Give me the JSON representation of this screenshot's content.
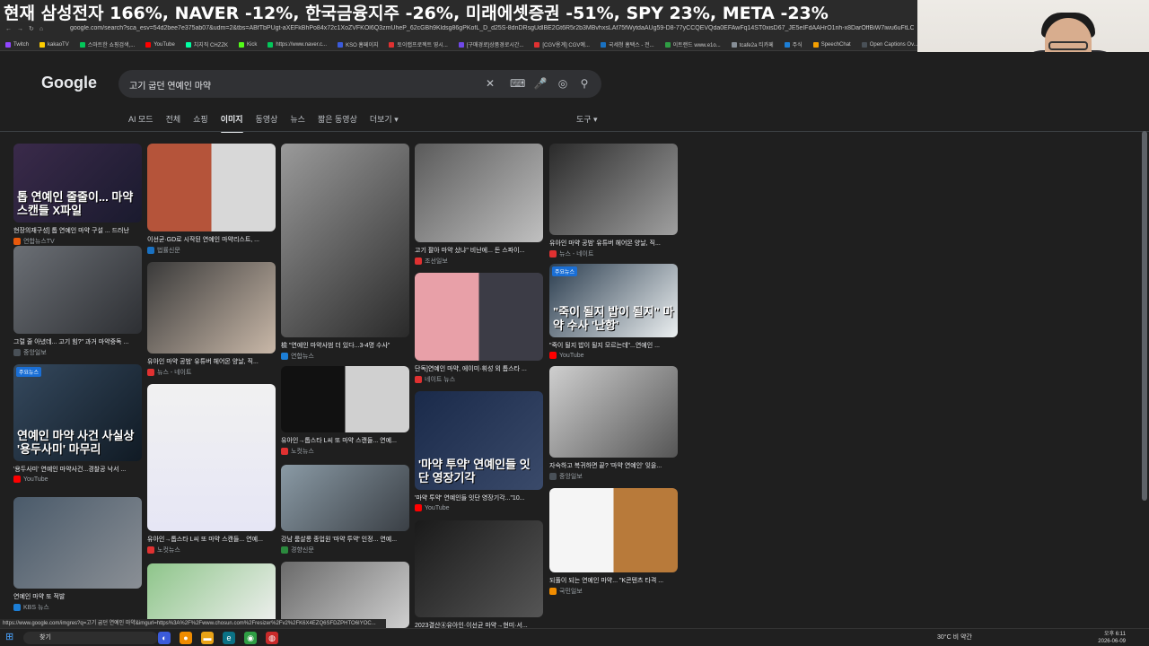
{
  "ticker": {
    "text": "현재 삼성전자 166%, NAVER -12%, 한국금융지주 -26%, 미래에셋증권 -51%, SPY 23%, META -23%"
  },
  "browser": {
    "url": "google.com/search?sca_esv=54d2bee7e375ab07&udm=2&tbs=ABfTbPUgt-aXEFkBhPo84x72c1XoZVFKOl6Q3zmUheP_62cGBh9Kldsg86gPKofL_D_d25S-8dnDRsgUdlBE2Gt6R5r2b3MBvhxsLAf75fWytdaAUg59-D8-77yCCQEVQda0EFAwFq14ST0xisD67_JE5eIFdAAHrO1nh-x8DarOffBiW7iwu6uFtLCYezyV8",
    "bookmarks": [
      {
        "label": "Twitch",
        "color": "#9146ff"
      },
      {
        "label": "kakaoTV",
        "color": "#ffcd00"
      },
      {
        "label": "스마트한 쇼핑검색,...",
        "color": "#03c75a"
      },
      {
        "label": "YouTube",
        "color": "#ff0000"
      },
      {
        "label": "치지직 CHZZK",
        "color": "#00ffa3"
      },
      {
        "label": "Kick",
        "color": "#53fc18"
      },
      {
        "label": "https://www.naver.c...",
        "color": "#03c75a"
      },
      {
        "label": "KSO 홈페이지",
        "color": "#3b5bdb"
      },
      {
        "label": "토이랩프로젝트 영시...",
        "color": "#e03131"
      },
      {
        "label": "[구매경로]상품경로시간...",
        "color": "#7048e8"
      },
      {
        "label": "[CGV용계] CGV예...",
        "color": "#e03131"
      },
      {
        "label": "국세청 홈택스 - 전...",
        "color": "#1971c2"
      },
      {
        "label": "이트랜드 www.e1o...",
        "color": "#2f9e44"
      },
      {
        "label": "tcafe2a 티카페",
        "color": "#868e96"
      },
      {
        "label": "주식",
        "color": "#1c7ed6"
      },
      {
        "label": "SpeechChat",
        "color": "#f59f00"
      },
      {
        "label": "Open Captions Ov...",
        "color": "#495057"
      }
    ]
  },
  "google": {
    "logo": "Google",
    "query": "고기 굽던 연예인 마약",
    "tabs": [
      {
        "label": "AI 모드",
        "active": false
      },
      {
        "label": "전체",
        "active": false
      },
      {
        "label": "쇼핑",
        "active": false
      },
      {
        "label": "이미지",
        "active": true
      },
      {
        "label": "동영상",
        "active": false
      },
      {
        "label": "뉴스",
        "active": false
      },
      {
        "label": "짧은 동영상",
        "active": false
      },
      {
        "label": "더보기 ▾",
        "active": false
      }
    ],
    "tools": "도구 ▾"
  },
  "results": [
    {
      "caption": "현장의재구성] 톱 연예인 마약 구설 ... 드러난",
      "source": "연합뉴스TV",
      "overlay": "톱 연예인 줄줄이... 마약 스캔들 X파일",
      "fav": "#e8590c"
    },
    {
      "caption": "그럴 줄 아녔데... 고기 힘?\" 과거 마약중독 ...",
      "source": "중앙일보",
      "overlay": "",
      "fav": "#495057"
    },
    {
      "caption": "'용두사미' 연예인 마약사건...경찰공 낙서 ...",
      "source": "YouTube",
      "overlay": "연예인 마약 사건 사실상 '용두사미' 마무리",
      "badge": "주요뉴스",
      "fav": "#ff0000"
    },
    {
      "caption": "연예인 마약 또 적발",
      "source": "KBS 뉴스",
      "overlay": "",
      "fav": "#1c7ed6"
    },
    {
      "caption": "이선균·GD로 시작된 연예인 마약리스트, ...",
      "source": "법률신문",
      "overlay": "",
      "fav": "#1971c2"
    },
    {
      "caption": "유아인 마약 공범' 유튜버 헤어몬 양날, 직...",
      "source": "뉴스 - 네이트",
      "overlay": "",
      "fav": "#e03131"
    },
    {
      "caption": "유아인→톱스타 L씨 또 마약 스캔들... 연예...",
      "source": "노컷뉴스",
      "overlay": "",
      "fav": "#e03131"
    },
    {
      "caption": "",
      "source": "",
      "overlay": "",
      "fav": "#868e96"
    },
    {
      "caption": "檢 \"연예인 마약사범 더 있다...3-4명 수사\"",
      "source": "연합뉴스",
      "overlay": "",
      "fav": "#1c7ed6"
    },
    {
      "caption": "유아인→톱스타 L씨 또 마약 스캔들... 연예...",
      "source": "노컷뉴스",
      "overlay": "",
      "fav": "#e03131"
    },
    {
      "caption": "강남 룸살롱 종업원 '마약 투약' 인정... 연예...",
      "source": "경향신문",
      "overlay": "",
      "fav": "#2b8a3e"
    },
    {
      "caption": "",
      "source": "",
      "overlay": "",
      "fav": "#868e96"
    },
    {
      "caption": "고기 팔아 마약 샀냐\" 비난에... 돈 스파이...",
      "source": "조선일보",
      "overlay": "",
      "fav": "#e03131"
    },
    {
      "caption": "단독]연예인 마약, 에이미·휘성 외 톱스타 ...",
      "source": "네이트 뉴스",
      "overlay": "",
      "fav": "#e03131"
    },
    {
      "caption": "'마약 투약' 연예인들 잇단 영장기각...\"10...",
      "source": "YouTube",
      "overlay": "'마약 투약' 연예인들 잇단 영장기각",
      "fav": "#ff0000"
    },
    {
      "caption": "2023결산④유아인·이선균 마약→현미·서...",
      "source": "",
      "overlay": "",
      "fav": "#868e96"
    },
    {
      "caption": "유아인 마약 공범' 유튜버 헤어몬 양날, 직...",
      "source": "뉴스 - 네이트",
      "overlay": "",
      "fav": "#e03131"
    },
    {
      "caption": "\"죽이 될지 밥이 될지 모르는데\"...연예인 ...",
      "source": "YouTube",
      "overlay": "\"죽이 될지 밥이 될지\" 마약 수사 '난항'",
      "badge": "주요뉴스",
      "fav": "#ff0000"
    },
    {
      "caption": "자숙하고 복귀하면 끝? '마약 연예인' 잊을...",
      "source": "중앙일보",
      "overlay": "",
      "fav": "#495057"
    },
    {
      "caption": "되풀이 되는 연예인 마약... \"K콘텐츠 타격 ...",
      "source": "국민일보",
      "overlay": "",
      "fav": "#f08c00"
    }
  ],
  "status_url": "https://www.google.com/imgres?q=고기 굽던 연예인 마약&imgurl=https%3A%2F%2Fwww.chosun.com%2Fresizer%2Fv2%2FK6X4EZQ6SFDZPHTO6IYOC...",
  "taskbar": {
    "search": "찾기",
    "weather": "30°C 비 약간",
    "time": "오후 6:11",
    "date": "2026-06-09"
  }
}
